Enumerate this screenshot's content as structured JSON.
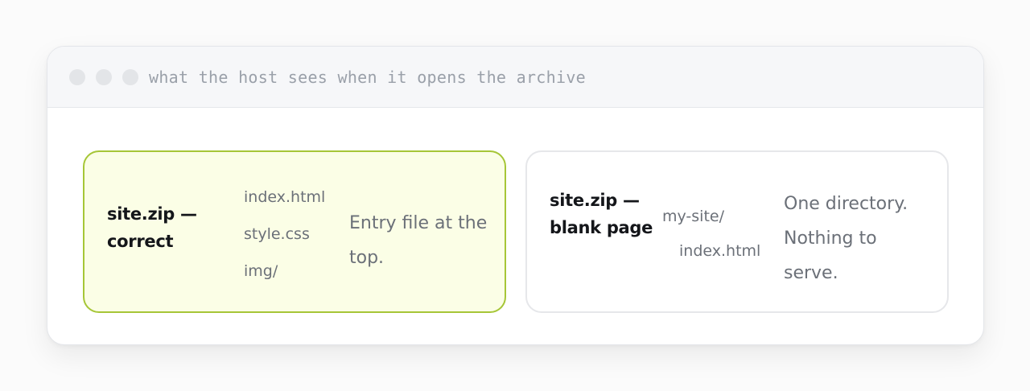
{
  "window": {
    "title": "what the host sees when it opens the archive"
  },
  "cards": [
    {
      "title": "site.zip — correct",
      "files": [
        "index.html",
        "style.css",
        "img/"
      ],
      "note": "Entry file at the top.",
      "accent": "#a6c637",
      "background": "#fbfee6"
    },
    {
      "title": "site.zip — blank page",
      "files": [
        "my-site/",
        "index.html"
      ],
      "note": "One directory. Nothing to serve.",
      "accent": "#e6e7ea",
      "background": "#ffffff"
    }
  ]
}
